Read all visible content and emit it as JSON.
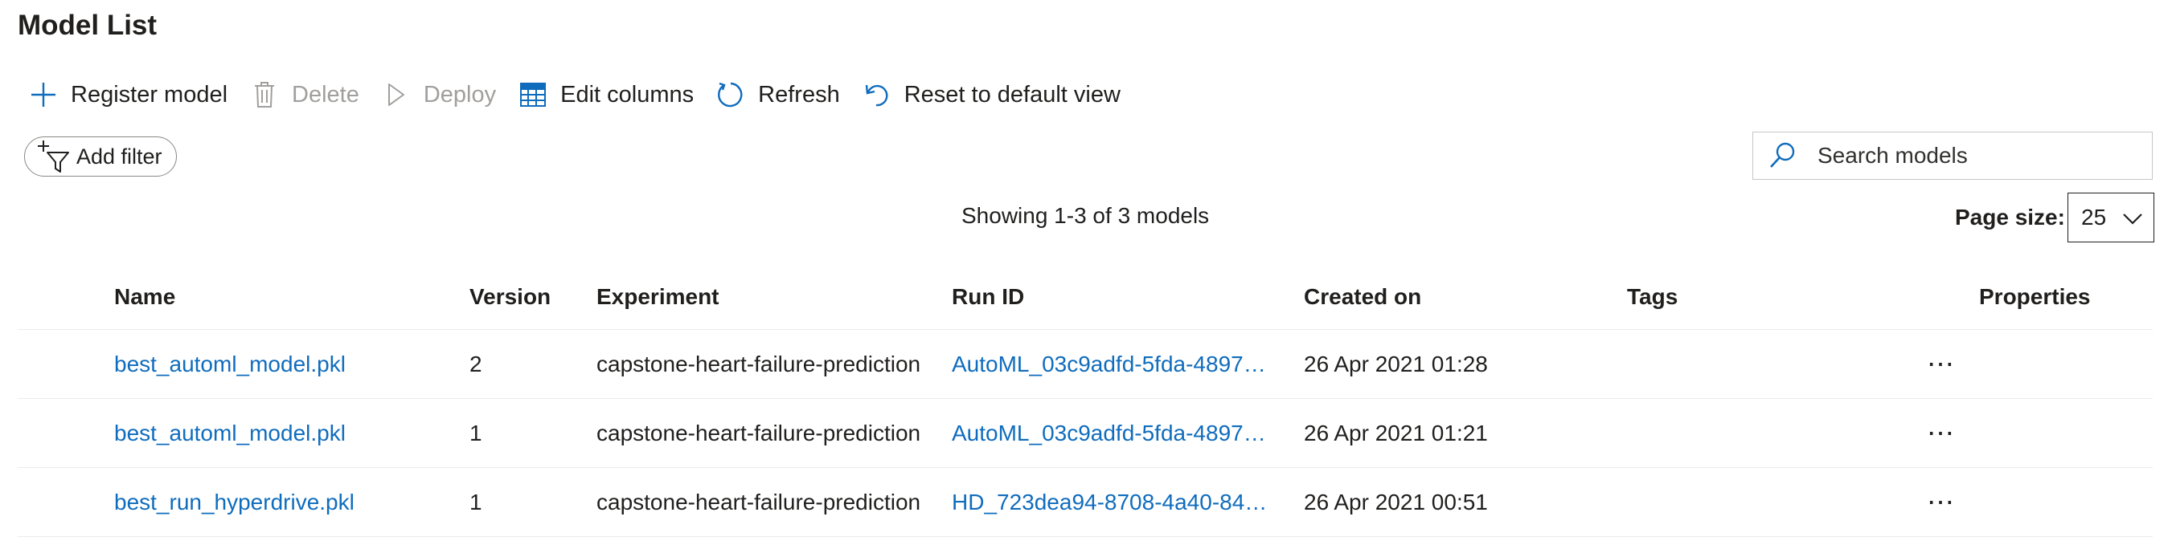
{
  "page": {
    "title": "Model List"
  },
  "toolbar": {
    "register": "Register model",
    "delete": "Delete",
    "deploy": "Deploy",
    "edit_columns": "Edit columns",
    "refresh": "Refresh",
    "reset": "Reset to default view"
  },
  "filter": {
    "add_label": "Add filter"
  },
  "search": {
    "placeholder": "Search models"
  },
  "summary": {
    "showing": "Showing 1-3 of 3 models"
  },
  "pagination": {
    "label": "Page size:",
    "value": "25"
  },
  "table": {
    "columns": {
      "name": "Name",
      "version": "Version",
      "experiment": "Experiment",
      "run_id": "Run ID",
      "created_on": "Created on",
      "tags": "Tags",
      "properties": "Properties"
    },
    "rows": [
      {
        "name": "best_automl_model.pkl",
        "version": "2",
        "experiment": "capstone-heart-failure-prediction",
        "run_id": "AutoML_03c9adfd-5fda-4897-9...",
        "created_on": "26 Apr 2021 01:28",
        "tags": "",
        "more": "⋯"
      },
      {
        "name": "best_automl_model.pkl",
        "version": "1",
        "experiment": "capstone-heart-failure-prediction",
        "run_id": "AutoML_03c9adfd-5fda-4897-9...",
        "created_on": "26 Apr 2021 01:21",
        "tags": "",
        "more": "⋯"
      },
      {
        "name": "best_run_hyperdrive.pkl",
        "version": "1",
        "experiment": "capstone-heart-failure-prediction",
        "run_id": "HD_723dea94-8708-4a40-8457...",
        "created_on": "26 Apr 2021 00:51",
        "tags": "",
        "more": "⋯"
      }
    ]
  },
  "icons": {
    "register": "plus-icon",
    "delete": "trash-icon",
    "deploy": "play-icon",
    "edit_columns": "table-columns-icon",
    "refresh": "refresh-icon",
    "reset": "undo-icon",
    "filter": "add-filter-icon",
    "search": "search-icon",
    "page_size": "chevron-down-icon"
  },
  "colors": {
    "accent": "#0f6cbd",
    "text": "#201f1e",
    "disabled": "#a19f9d",
    "divider": "#edebe9"
  }
}
